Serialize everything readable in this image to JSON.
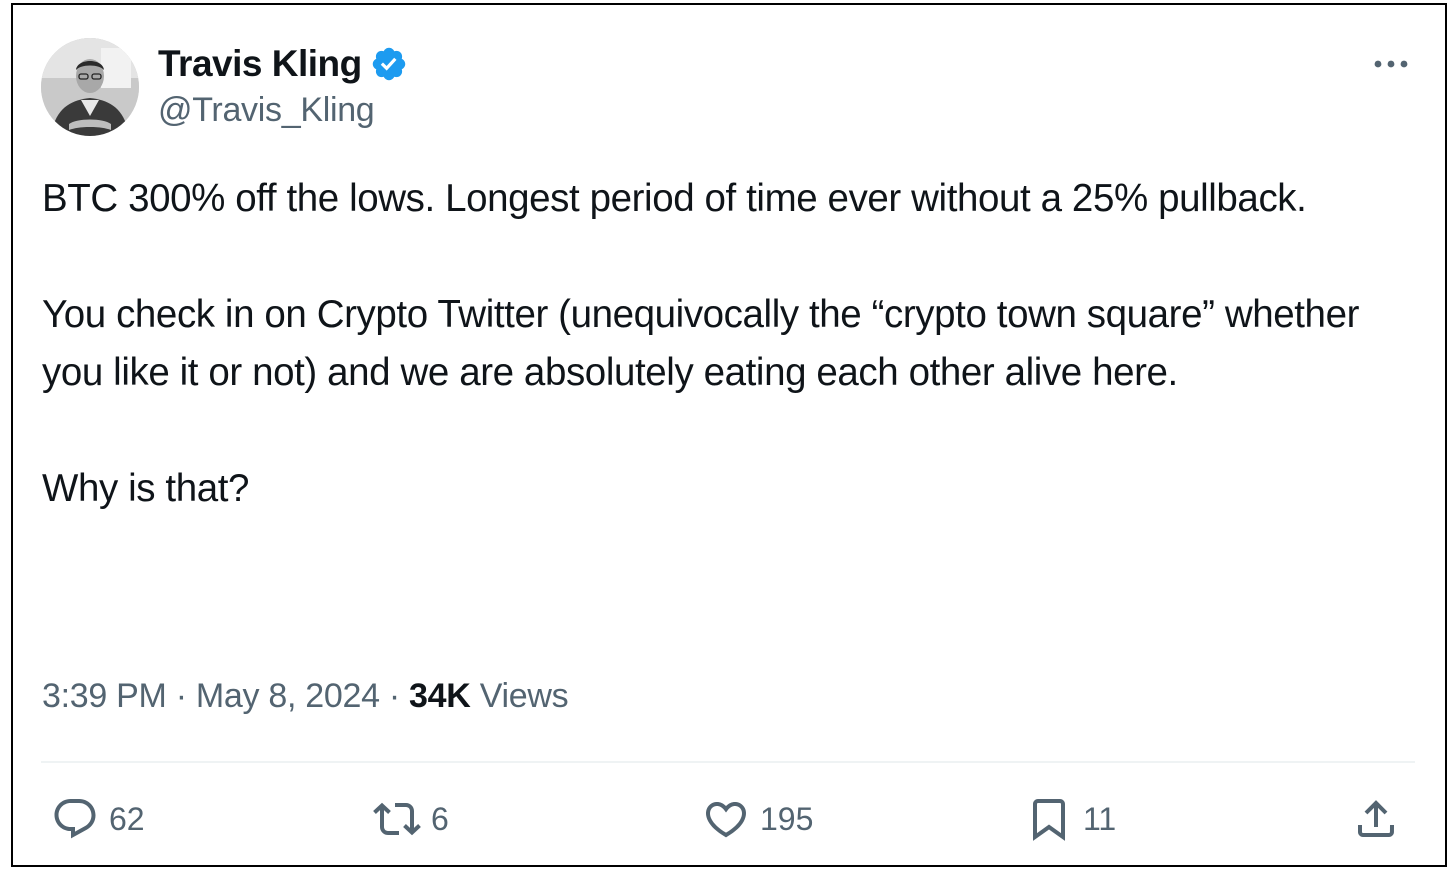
{
  "author": {
    "display_name": "Travis Kling",
    "handle": "@Travis_Kling",
    "verified": true,
    "verified_color": "#1d9bf0"
  },
  "tweet": {
    "paragraphs": [
      "BTC 300% off the lows. Longest period of time ever without a 25% pullback.",
      "You check in on Crypto Twitter (unequivocally the “crypto town square” whether you like it or not) and we are absolutely eating each other alive here.",
      "Why is that?"
    ],
    "time": "3:39 PM",
    "separator": "·",
    "date": "May 8, 2024",
    "views_count": "34K",
    "views_label": "Views"
  },
  "actions": {
    "replies": {
      "icon": "reply-icon",
      "count": "62"
    },
    "reposts": {
      "icon": "repost-icon",
      "count": "6"
    },
    "likes": {
      "icon": "heart-icon",
      "count": "195"
    },
    "bookmarks": {
      "icon": "bookmark-icon",
      "count": "11"
    },
    "share": {
      "icon": "share-icon"
    }
  },
  "colors": {
    "text": "#0f1419",
    "secondary": "#536471",
    "divider": "#eff3f4"
  }
}
